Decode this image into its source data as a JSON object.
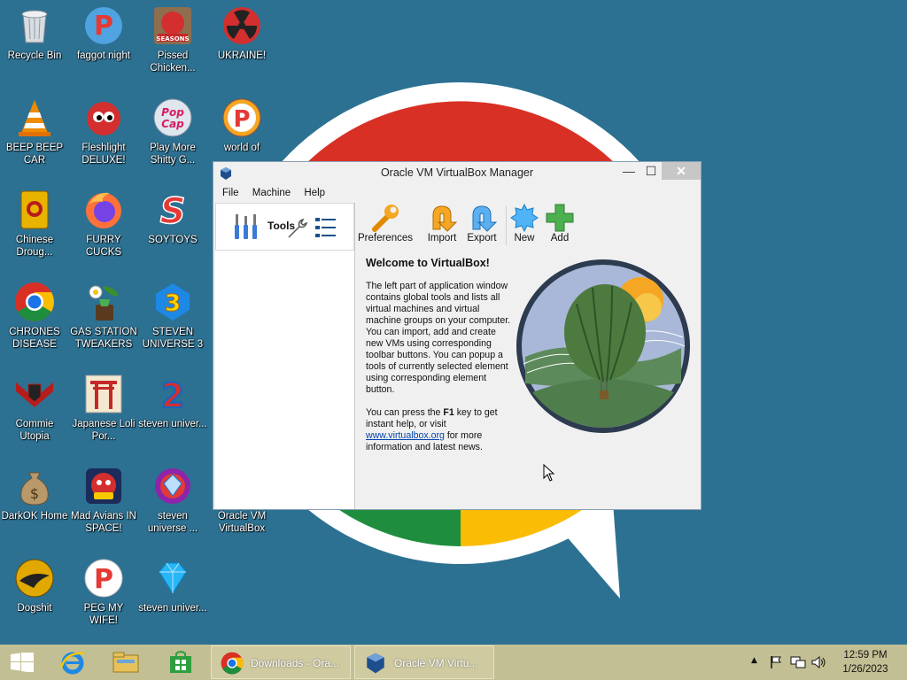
{
  "desktop": {
    "icons": [
      {
        "label": "Recycle Bin"
      },
      {
        "label": "faggot night"
      },
      {
        "label": "Pissed Chicken..."
      },
      {
        "label": "UKRAINE!"
      },
      {
        "label": "BEEP BEEP CAR"
      },
      {
        "label": "Fleshlight DELUXE!"
      },
      {
        "label": "Play More Shitty G..."
      },
      {
        "label": "world of"
      },
      {
        "label": "Chinese Droug..."
      },
      {
        "label": "FURRY CUCKS"
      },
      {
        "label": "SOYTOYS"
      },
      {
        "label": "CHRONES DISEASE"
      },
      {
        "label": "GAS STATION TWEAKERS"
      },
      {
        "label": "STEVEN UNIVERSE 3"
      },
      {
        "label": "Commie Utopia"
      },
      {
        "label": "Japanese Loli Por..."
      },
      {
        "label": "steven univer..."
      },
      {
        "label": "DarkOK Home"
      },
      {
        "label": "Mad Avians IN SPACE!"
      },
      {
        "label": "steven universe ..."
      },
      {
        "label": "Oracle VM VirtualBox"
      },
      {
        "label": "Dogshit"
      },
      {
        "label": "PEG MY WIFE!"
      },
      {
        "label": "steven univer..."
      }
    ],
    "icon_glyphs": {
      "pissed_seasons": "SEASONS",
      "popcap_1": "Pop",
      "popcap_2": "Cap",
      "steven3": "3",
      "steven2": "2"
    }
  },
  "window": {
    "title": "Oracle VM VirtualBox Manager",
    "menu": [
      "File",
      "Machine",
      "Help"
    ],
    "tools_label": "Tools",
    "toolbar": [
      {
        "label": "Preferences"
      },
      {
        "label": "Import"
      },
      {
        "label": "Export"
      },
      {
        "label": "New"
      },
      {
        "label": "Add"
      }
    ],
    "welcome": {
      "heading": "Welcome to VirtualBox!",
      "para1": "The left part of application window contains global tools and lists all virtual machines and virtual machine groups on your computer. You can import, add and create new VMs using corresponding toolbar buttons. You can popup a tools of currently selected element using corresponding element button.",
      "para2_before": "You can press the ",
      "para2_key": "F1",
      "para2_mid": " key to get instant help, or visit ",
      "para2_link": "www.virtualbox.org",
      "para2_after": " for more information and latest news."
    }
  },
  "taskbar": {
    "apps": [
      {
        "label": "Downloads - Ora..."
      },
      {
        "label": "Oracle VM Virtu..."
      }
    ],
    "clock_time": "12:59 PM",
    "clock_date": "1/26/2023"
  },
  "colors": {
    "desktop_bg": "#2c7192",
    "taskbar": "#c3bf94",
    "chrome_red": "#d93025",
    "chrome_green": "#1e8e3e",
    "chrome_yellow": "#fbbc04"
  }
}
